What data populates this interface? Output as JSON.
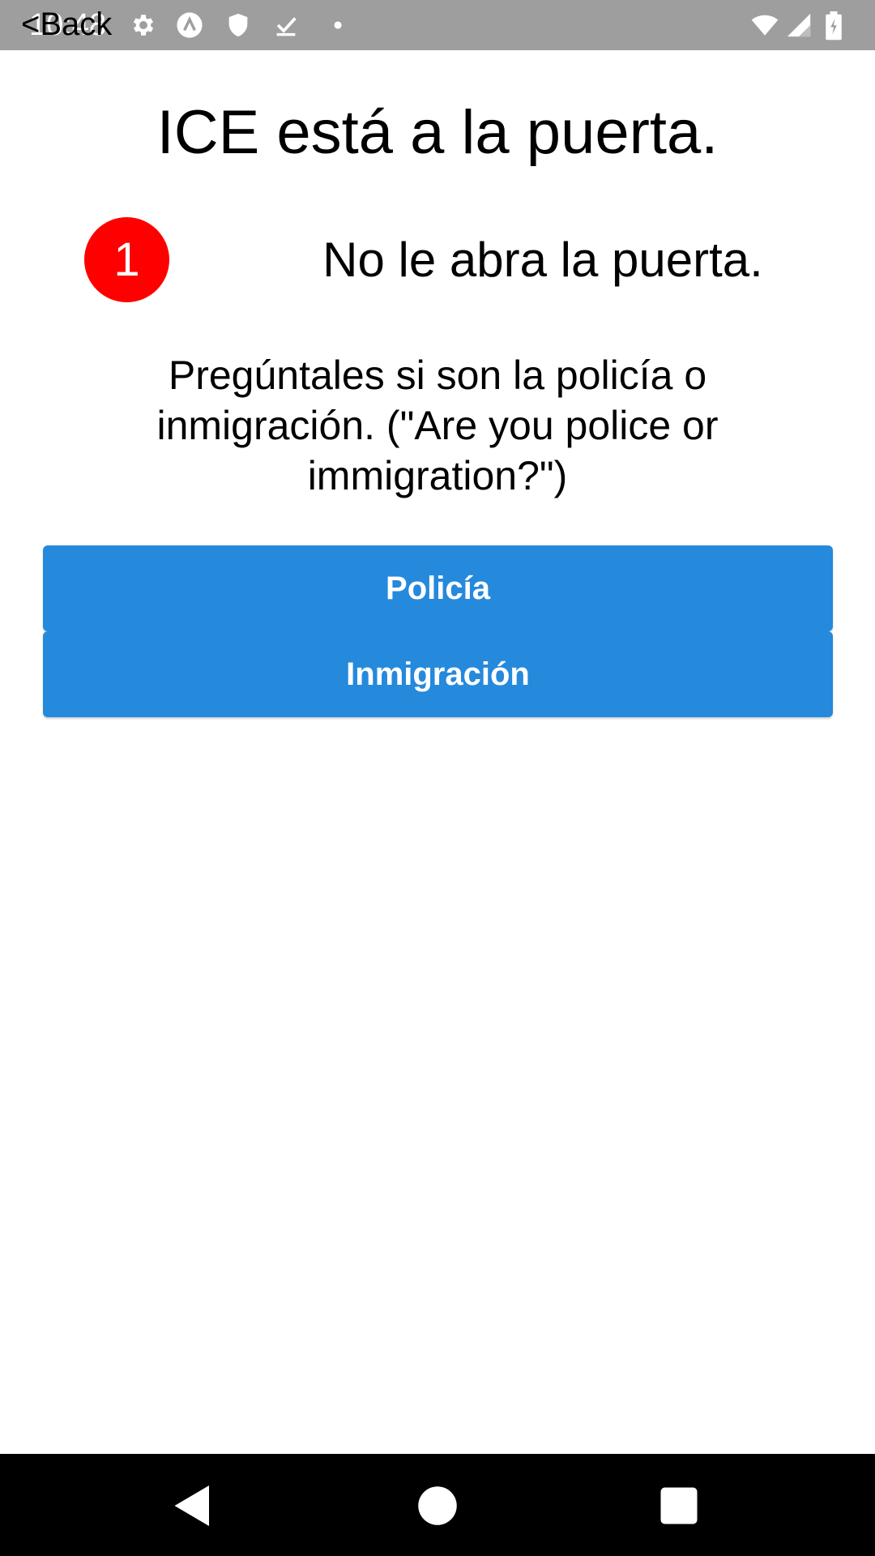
{
  "status_bar": {
    "time": "10:48",
    "back_label": "<Back",
    "icons": [
      "settings-icon",
      "app-a-icon",
      "shield-icon",
      "download-done-icon",
      "dot-icon",
      "wifi-icon",
      "signal-icon",
      "battery-icon"
    ]
  },
  "content": {
    "title": "ICE está a la puerta.",
    "step_number": "1",
    "step_text": "No le abra la puerta.",
    "prompt": "Pregúntales si son la policía o inmigración. (\"Are you police or immigration?\")",
    "buttons": {
      "police": "Policía",
      "immigration": "Inmigración"
    }
  },
  "nav_bar": {
    "icons": [
      "back-nav-icon",
      "home-nav-icon",
      "recents-nav-icon"
    ]
  },
  "colors": {
    "status_bar": "#9e9e9e",
    "badge": "#ff0000",
    "button": "#2589dc",
    "nav_bar": "#000000"
  }
}
